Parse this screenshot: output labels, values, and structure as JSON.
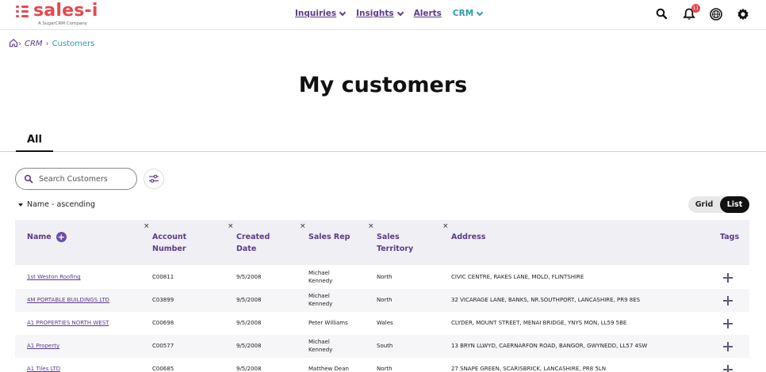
{
  "brand": {
    "name": "sales-i",
    "tagline": "A SugarCRM Company",
    "color": "#e5484d"
  },
  "nav": {
    "items": [
      {
        "label": "Inquiries",
        "dropdown": true
      },
      {
        "label": "Insights",
        "dropdown": true
      },
      {
        "label": "Alerts",
        "dropdown": false
      },
      {
        "label": "CRM",
        "dropdown": true,
        "active": true
      }
    ],
    "notification_count": "11"
  },
  "breadcrumb": {
    "items": [
      "CRM"
    ],
    "current": "Customers"
  },
  "page": {
    "title": "My customers"
  },
  "tabs": [
    {
      "label": "All",
      "active": true
    }
  ],
  "search": {
    "placeholder": "Search Customers"
  },
  "sort": {
    "label": "Name - ascending"
  },
  "view_toggle": {
    "grid": "Grid",
    "list": "List",
    "selected": "List"
  },
  "table": {
    "headers": {
      "name": "Name",
      "account": [
        "Account",
        "Number"
      ],
      "created": [
        "Created",
        "Date"
      ],
      "rep": "Sales Rep",
      "territory": [
        "Sales",
        "Territory"
      ],
      "address": "Address",
      "tags": "Tags"
    },
    "remove_glyph": "×",
    "rows": [
      {
        "name": "1st Weston Roofing",
        "account": "C00811",
        "created": "9/5/2008",
        "rep": [
          "Michael",
          "Kennedy"
        ],
        "territory": "North",
        "address": "CIVIC CENTRE, RAKES LANE, MOLD, FLINTSHIRE"
      },
      {
        "name": "4M PORTABLE BUILDINGS LTD",
        "account": "C03899",
        "created": "9/5/2008",
        "rep": [
          "Michael",
          "Kennedy"
        ],
        "territory": "North",
        "address": "32 VICARAGE LANE, BANKS, NR.SOUTHPORT, LANCASHIRE, PR9 8ES"
      },
      {
        "name": "A1 PROPERTIES NORTH WEST",
        "account": "C00698",
        "created": "9/5/2008",
        "rep": [
          "Peter Williams"
        ],
        "territory": "Wales",
        "address": "CLYDER, MOUNT STREET, MENAI BRIDGE, YNYS MON, LL59 5BE"
      },
      {
        "name": "A1 Property",
        "account": "C00577",
        "created": "9/5/2008",
        "rep": [
          "Michael",
          "Kennedy"
        ],
        "territory": "South",
        "address": "13 BRYN LLWYD, CAERNARFON ROAD, BANGOR, GWYNEDD, LL57 4SW"
      },
      {
        "name": "A1 Tiles LTD",
        "account": "C00685",
        "created": "9/5/2008",
        "rep": [
          "Matthew Dean"
        ],
        "territory": "North",
        "address": "27 SNAPE GREEN, SCARISBRICK, LANCASHIRE, PR8 5LN"
      }
    ]
  }
}
